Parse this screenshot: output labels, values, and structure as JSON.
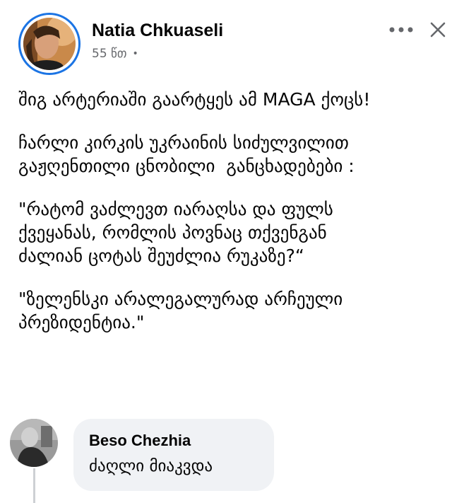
{
  "post": {
    "author": "Natia Chkuaseli",
    "time": "55 წთ",
    "privacy_icon": "globe-icon",
    "paragraphs": [
      [
        "შიგ არტერიაში გაარტყეს ამ MAGA ქოცს!"
      ],
      [
        "ჩარლი კირკის უკრაინის სიძულვილით",
        "გაჟღენთილი ცნობილი  განცხადებები :"
      ],
      [
        "\"რატომ ვაძლევთ იარაღსა და ფულს",
        "ქვეყანას, რომლის პოვნაც თქვენგან",
        "ძალიან ცოტას შეუძლია რუკაზე?“"
      ],
      [
        "\"ზელენსკი არალეგალურად არჩეული",
        "პრეზიდენტია.\""
      ]
    ]
  },
  "header_actions": {
    "more_icon": "more-horizontal-icon",
    "close_icon": "close-icon"
  },
  "comment": {
    "author": "Beso Chezhia",
    "text": "ძაღლი მიაკვდა"
  }
}
